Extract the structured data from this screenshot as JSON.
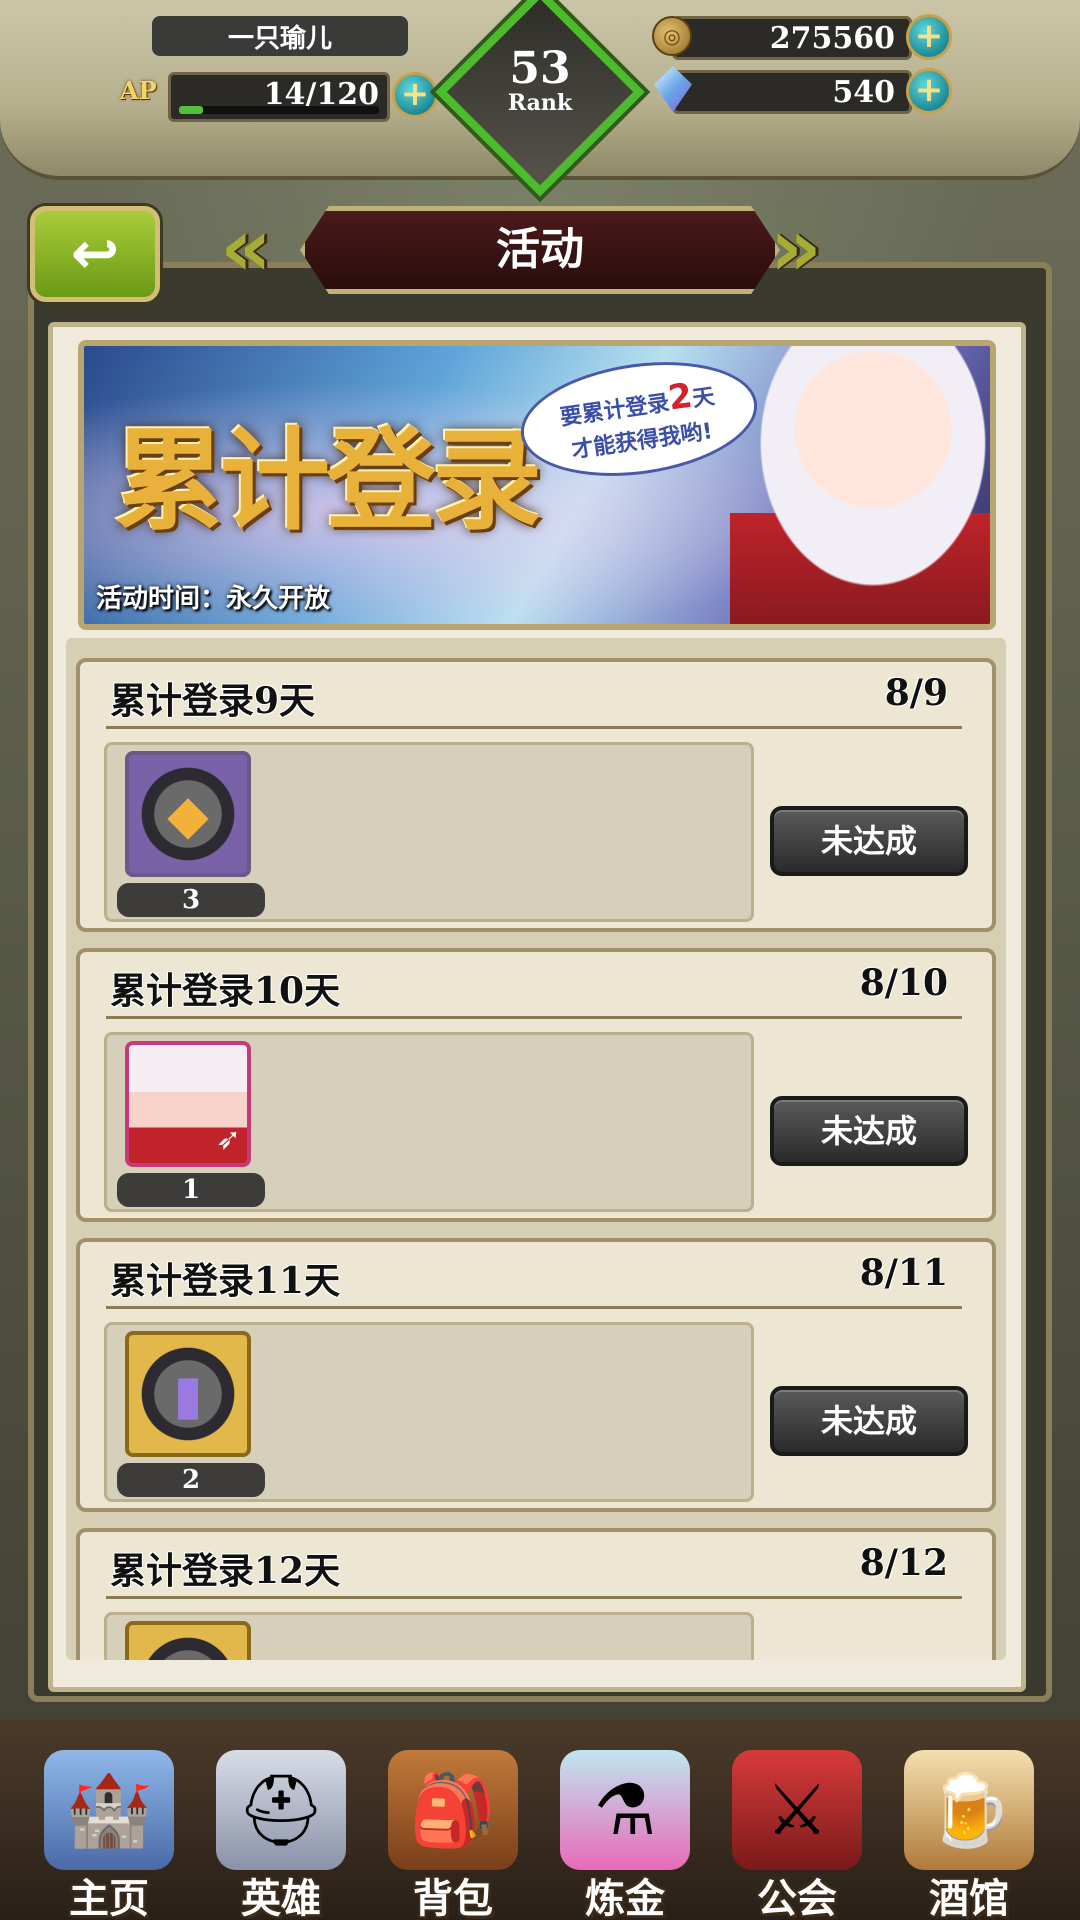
{
  "topbar": {
    "player_name": "一只瑜儿",
    "ap_label": "AP",
    "ap_value": "14/120",
    "ap_fraction": 0.12,
    "rank_number": "53",
    "rank_label": "Rank",
    "gold": "275560",
    "gems": "540"
  },
  "header": {
    "title": "活动"
  },
  "banner": {
    "title": "累计登录",
    "bubble_line1": "要累计登录",
    "bubble_highlight": "2",
    "bubble_line1_end": "天",
    "bubble_line2": "才能获得我哟!",
    "time_text": "活动时间：永久开放"
  },
  "rewards": [
    {
      "title": "累计登录9天",
      "progress": "8/9",
      "count": "3",
      "status": "未达成"
    },
    {
      "title": "累计登录10天",
      "progress": "8/10",
      "count": "1",
      "status": "未达成"
    },
    {
      "title": "累计登录11天",
      "progress": "8/11",
      "count": "2",
      "status": "未达成"
    },
    {
      "title": "累计登录12天",
      "progress": "8/12",
      "count": "",
      "status": ""
    }
  ],
  "nav": [
    {
      "label": "主页",
      "icon": "castle-icon"
    },
    {
      "label": "英雄",
      "icon": "knight-helmet-icon"
    },
    {
      "label": "背包",
      "icon": "backpack-icon"
    },
    {
      "label": "炼金",
      "icon": "potion-icon"
    },
    {
      "label": "公会",
      "icon": "guild-shield-icon"
    },
    {
      "label": "酒馆",
      "icon": "tavern-food-icon"
    }
  ],
  "colors": {
    "rank_border": "#4bbd2a",
    "back_button": "#8ab628",
    "status_button": "#3a3a3a",
    "panel_bg": "#efeadb"
  }
}
